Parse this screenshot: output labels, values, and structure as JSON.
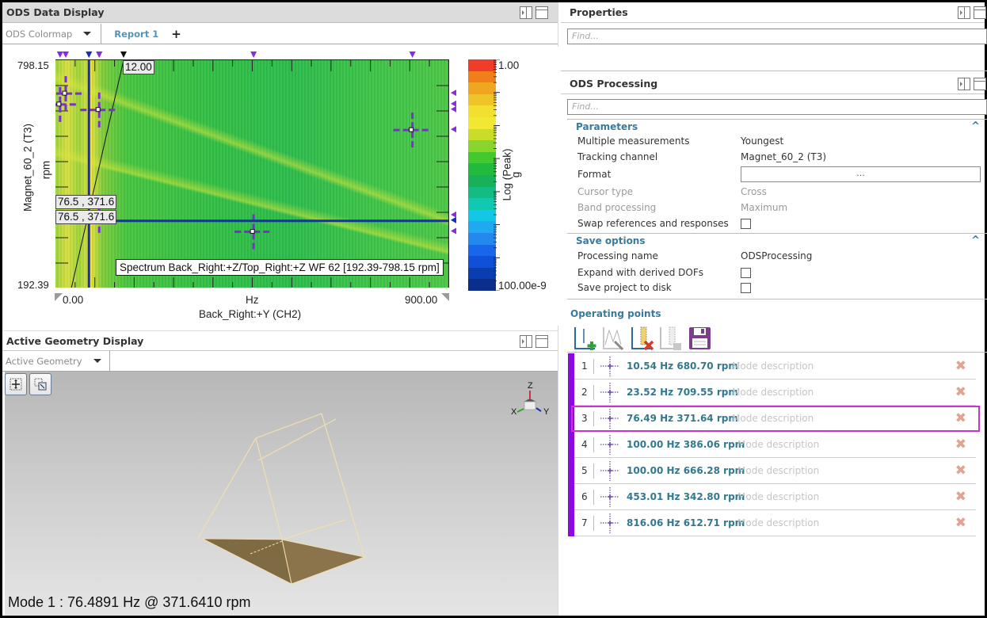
{
  "left_top_panel": {
    "title": "ODS Data Display",
    "tabs": {
      "dropdown_label": "ODS Colormap",
      "active_tab": "Report 1",
      "add_tab": "+"
    },
    "colormap": {
      "y_top": "798.15",
      "y_bottom": "192.39",
      "x_left": "0.00",
      "x_right": "900.00",
      "x_unit": "Hz",
      "x_channel": "Back_Right:+Y (CH2)",
      "y_channel": "Magnet_60_2 (T3)",
      "y_unit": "rpm",
      "colorbar_max": "1.00",
      "colorbar_min": "100.00e-9",
      "colorbar_label": "Log (Peak)",
      "colorbar_unit": "g",
      "order_label": "12.00",
      "cursor_readout_1": "76.5 , 371.6",
      "cursor_readout_2": "76.5 , 371.6",
      "tooltip": "Spectrum Back_Right:+Z/Top_Right:+Z WF 62 [192.39-798.15 rpm]"
    }
  },
  "chart_data": {
    "type": "heatmap",
    "title": "ODS Colormap",
    "xlabel": "Hz — Back_Right:+Y (CH2)",
    "ylabel": "Magnet_60_2 (T3) rpm",
    "xlim": [
      0.0,
      900.0
    ],
    "ylim": [
      192.39,
      798.15
    ],
    "colorbar": {
      "label": "Log (Peak) g",
      "range": [
        1e-07,
        1.0
      ],
      "scale": "log",
      "colors": [
        "#0b2d8c",
        "#0a3db0",
        "#1050d8",
        "#1a66ea",
        "#2488ee",
        "#20a8f0",
        "#14c6e8",
        "#10c9b0",
        "#14bc84",
        "#18b058",
        "#22ba3c",
        "#45c82e",
        "#8ad42e",
        "#c8dc2a",
        "#f0e832",
        "#f2e030",
        "#eec528",
        "#f0a61e",
        "#f07e1a",
        "#ee3e2a"
      ]
    },
    "markers": [
      {
        "id": 1,
        "hz": 10.54,
        "rpm": 680.7
      },
      {
        "id": 2,
        "hz": 23.52,
        "rpm": 709.55
      },
      {
        "id": 3,
        "hz": 76.49,
        "rpm": 371.64
      },
      {
        "id": 4,
        "hz": 100.0,
        "rpm": 386.06
      },
      {
        "id": 5,
        "hz": 100.0,
        "rpm": 666.28
      },
      {
        "id": 6,
        "hz": 453.01,
        "rpm": 342.8
      },
      {
        "id": 7,
        "hz": 816.06,
        "rpm": 612.71
      }
    ],
    "active_cursor": {
      "hz": 76.5,
      "rpm": 371.6
    },
    "order_line": 12.0
  },
  "left_bottom_panel": {
    "title": "Active Geometry Display",
    "dropdown_label": "Active Geometry",
    "mode_text": "Mode  1 : 76.4891 Hz @ 371.6410 rpm",
    "axes": {
      "x": "X",
      "y": "Y",
      "z": "Z"
    }
  },
  "properties_panel": {
    "title": "Properties",
    "find_placeholder": "Find..."
  },
  "ods_processing": {
    "title": "ODS Processing",
    "find_placeholder": "Find...",
    "parameters": {
      "title": "Parameters",
      "rows": [
        {
          "label": "Multiple measurements",
          "value": "Youngest"
        },
        {
          "label": "Tracking channel",
          "value": "Magnet_60_2 (T3)"
        },
        {
          "label": "Format",
          "value": "..."
        },
        {
          "label": "Cursor type",
          "value": "Cross"
        },
        {
          "label": "Band processing",
          "value": "Maximum"
        },
        {
          "label": "Swap references and responses",
          "checked": false
        }
      ]
    },
    "save_options": {
      "title": "Save options",
      "rows": [
        {
          "label": "Processing name",
          "value": "ODSProcessing"
        },
        {
          "label": "Expand with derived DOFs",
          "checked": false
        },
        {
          "label": "Save project to disk",
          "checked": false
        }
      ]
    },
    "operating_points": {
      "title": "Operating points",
      "items": [
        {
          "index": "1",
          "value": "10.54  Hz 680.70  rpm",
          "desc": "Mode description",
          "selected": false
        },
        {
          "index": "2",
          "value": "23.52  Hz 709.55  rpm",
          "desc": "Mode description",
          "selected": false
        },
        {
          "index": "3",
          "value": "76.49  Hz 371.64  rpm",
          "desc": "Mode description",
          "selected": true
        },
        {
          "index": "4",
          "value": "100.00  Hz 386.06  rpm",
          "desc": "Mode description",
          "selected": false
        },
        {
          "index": "5",
          "value": "100.00  Hz 666.28  rpm",
          "desc": "Mode description",
          "selected": false
        },
        {
          "index": "6",
          "value": "453.01  Hz 342.80  rpm",
          "desc": "Mode description",
          "selected": false
        },
        {
          "index": "7",
          "value": "816.06  Hz 612.71  rpm",
          "desc": "Mode description",
          "selected": false
        }
      ]
    }
  },
  "colors": {
    "accent_purple": "#8a0ae0",
    "cursor_blue": "#1a2db8",
    "selected_border": "#cc33cc",
    "section_title": "#3a7a9a",
    "value_text": "#33788f",
    "delete_x": "#e3a393"
  }
}
